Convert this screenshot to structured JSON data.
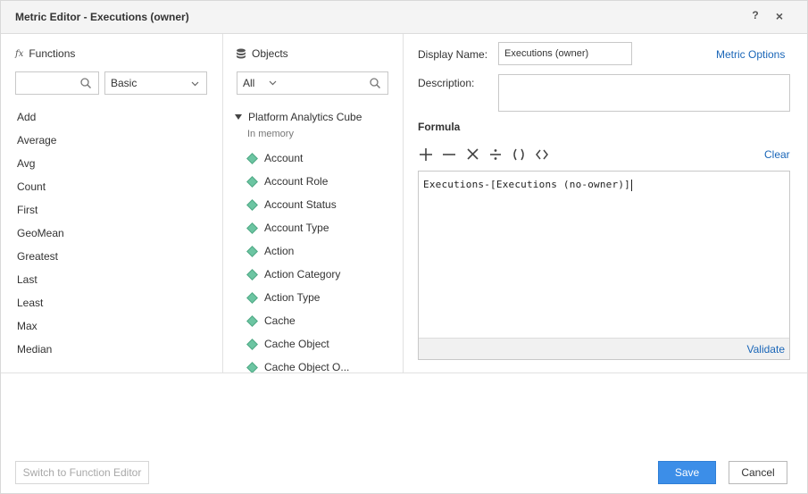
{
  "window": {
    "title": "Metric Editor - Executions (owner)",
    "help_label": "?",
    "close_label": "×"
  },
  "functions_panel": {
    "heading": "Functions",
    "search_value": "",
    "category_selected": "Basic",
    "items": [
      "Add",
      "Average",
      "Avg",
      "Count",
      "First",
      "GeoMean",
      "Greatest",
      "Last",
      "Least",
      "Max",
      "Median"
    ]
  },
  "objects_panel": {
    "heading": "Objects",
    "filter_selected": "All",
    "search_value": "",
    "cube_name": "Platform Analytics Cube",
    "cube_status": "In memory",
    "items": [
      "Account",
      "Account Role",
      "Account Status",
      "Account Type",
      "Action",
      "Action Category",
      "Action Type",
      "Cache",
      "Cache Object",
      "Cache Object O..."
    ]
  },
  "editor": {
    "display_name_label": "Display Name:",
    "display_name_value": "Executions (owner)",
    "description_label": "Description:",
    "description_value": "",
    "metric_options_label": "Metric Options",
    "formula_heading": "Formula",
    "operators": [
      "plus-icon",
      "minus-icon",
      "multiply-icon",
      "divide-icon",
      "parentheses-icon",
      "angle-brackets-icon"
    ],
    "clear_label": "Clear",
    "formula_text": "Executions-[Executions (no-owner)]",
    "validate_label": "Validate"
  },
  "footer": {
    "switch_label": "Switch to Function Editor",
    "save_label": "Save",
    "cancel_label": "Cancel"
  },
  "colors": {
    "accent": "#3c8ee8",
    "link": "#1a66b8",
    "attribute_icon": "#6cc5a2"
  }
}
